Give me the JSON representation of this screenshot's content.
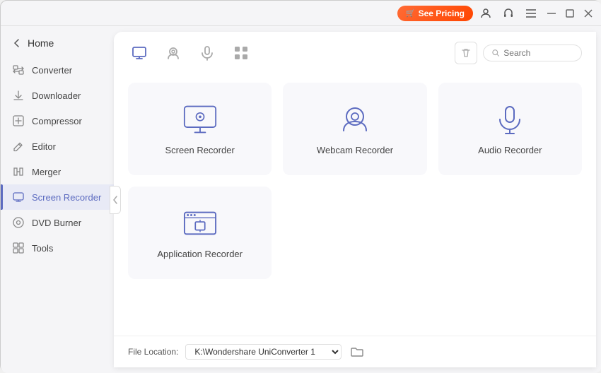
{
  "titlebar": {
    "see_pricing_label": "See Pricing",
    "cart_icon": "🛒",
    "user_icon": "👤",
    "headset_icon": "🎧",
    "menu_icon": "☰",
    "minimize_icon": "─",
    "maximize_icon": "□",
    "close_icon": "✕"
  },
  "sidebar": {
    "home_label": "Home",
    "items": [
      {
        "id": "converter",
        "label": "Converter"
      },
      {
        "id": "downloader",
        "label": "Downloader"
      },
      {
        "id": "compressor",
        "label": "Compressor"
      },
      {
        "id": "editor",
        "label": "Editor"
      },
      {
        "id": "merger",
        "label": "Merger"
      },
      {
        "id": "screen-recorder",
        "label": "Screen Recorder",
        "active": true
      },
      {
        "id": "dvd-burner",
        "label": "DVD Burner"
      },
      {
        "id": "tools",
        "label": "Tools"
      }
    ]
  },
  "content": {
    "search_placeholder": "Search",
    "tabs": [
      {
        "id": "screen",
        "label": "Screen"
      },
      {
        "id": "webcam",
        "label": "Webcam"
      },
      {
        "id": "audio",
        "label": "Audio"
      },
      {
        "id": "apps",
        "label": "Apps"
      }
    ],
    "recorders": [
      {
        "id": "screen-recorder",
        "label": "Screen Recorder"
      },
      {
        "id": "webcam-recorder",
        "label": "Webcam Recorder"
      },
      {
        "id": "audio-recorder",
        "label": "Audio Recorder"
      },
      {
        "id": "application-recorder",
        "label": "Application Recorder"
      }
    ]
  },
  "footer": {
    "file_location_label": "File Location:",
    "path_value": "K:\\Wondershare UniConverter 1",
    "path_options": [
      "K:\\Wondershare UniConverter 1"
    ]
  }
}
